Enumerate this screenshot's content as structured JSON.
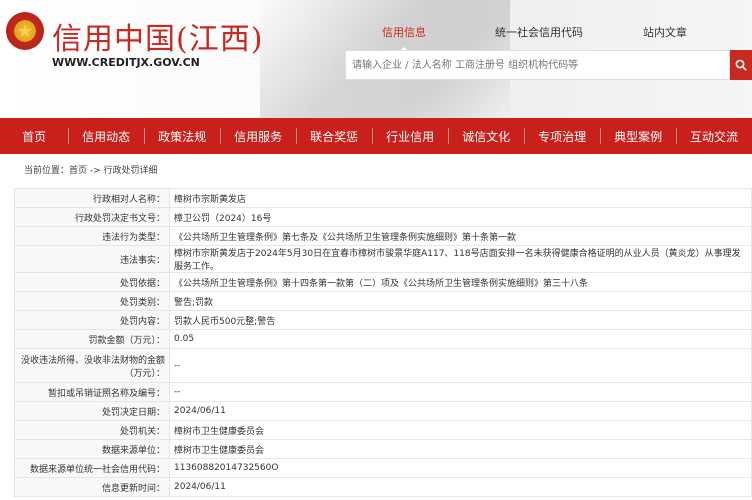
{
  "header": {
    "title": "信用中国(江西)",
    "url": "WWW.CREDITJX.GOV.CN",
    "tabs": [
      "信用信息",
      "统一社会信用代码",
      "站内文章"
    ],
    "search_placeholder": "请输入企业 / 法人名称 工商注册号 组织机构代码等"
  },
  "nav": [
    "首页",
    "信用动态",
    "政策法规",
    "信用服务",
    "联合奖惩",
    "行业信用",
    "诚信文化",
    "专项治理",
    "典型案例",
    "互动交流"
  ],
  "breadcrumb": "当前位置：首页 -> 行政处罚详细",
  "details": [
    {
      "label": "行政相对人名称：",
      "value": "樟树市宗斯黄发店"
    },
    {
      "label": "行政处罚决定书文号：",
      "value": "樟卫公罚（2024）16号"
    },
    {
      "label": "违法行为类型：",
      "value": "《公共场所卫生管理条例》第七条及《公共场所卫生管理条例实施细则》第十条第一款"
    },
    {
      "label": "违法事实：",
      "value": "樟树市宗斯黄发店于2024年5月30日在宜春市樟树市骏景华庭A117、118号店面安排一名未获得健康合格证明的从业人员（黄炎龙）从事理发服务工作。"
    },
    {
      "label": "处罚依据：",
      "value": "《公共场所卫生管理条例》第十四条第一款第（二）项及《公共场所卫生管理条例实施细则》第三十八条"
    },
    {
      "label": "处罚类别：",
      "value": "警告;罚款"
    },
    {
      "label": "处罚内容：",
      "value": "罚款人民币500元整;警告"
    },
    {
      "label": "罚款金额（万元）：",
      "value": "0.05"
    },
    {
      "label": "没收违法所得、没收非法财物的金额（万元）：",
      "value": "--"
    },
    {
      "label": "暂扣或吊销证照名称及编号：",
      "value": "--"
    },
    {
      "label": "处罚决定日期：",
      "value": "2024/06/11"
    },
    {
      "label": "处罚机关：",
      "value": "樟树市卫生健康委员会"
    },
    {
      "label": "数据来源单位：",
      "value": "樟树市卫生健康委员会"
    },
    {
      "label": "数据来源单位统一社会信用代码：",
      "value": "11360882014732560O"
    },
    {
      "label": "信息更新时间：",
      "value": "2024/06/11"
    }
  ],
  "colors": {
    "brand_red": "#c9201b"
  },
  "icons": {
    "emblem": "national-emblem-icon",
    "search": "search-icon"
  }
}
